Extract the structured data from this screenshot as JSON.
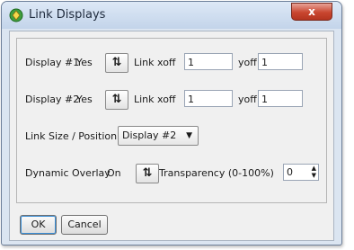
{
  "window": {
    "title": "Link Displays",
    "close_glyph": "x"
  },
  "rows": {
    "display1": {
      "label": "Display #1",
      "value": "Yes",
      "xoff_label": "Link xoff",
      "xoff": "1",
      "yoff_label": "yoff",
      "yoff": "1"
    },
    "display2": {
      "label": "Display #2",
      "value": "Yes",
      "xoff_label": "Link xoff",
      "xoff": "1",
      "yoff_label": "yoff",
      "yoff": "1"
    }
  },
  "link_size": {
    "label": "Link Size / Position",
    "selected": "Display #2"
  },
  "overlay": {
    "label": "Dynamic Overlay",
    "value": "On",
    "transparency_label": "Transparency (0-100%)",
    "transparency": "0"
  },
  "buttons": {
    "ok": "OK",
    "cancel": "Cancel"
  },
  "icons": {
    "app": "link-app-icon",
    "swap": "swap-arrows-icon",
    "dropdown": "chevron-down-icon",
    "spinner": "spinner-arrows-icon"
  }
}
